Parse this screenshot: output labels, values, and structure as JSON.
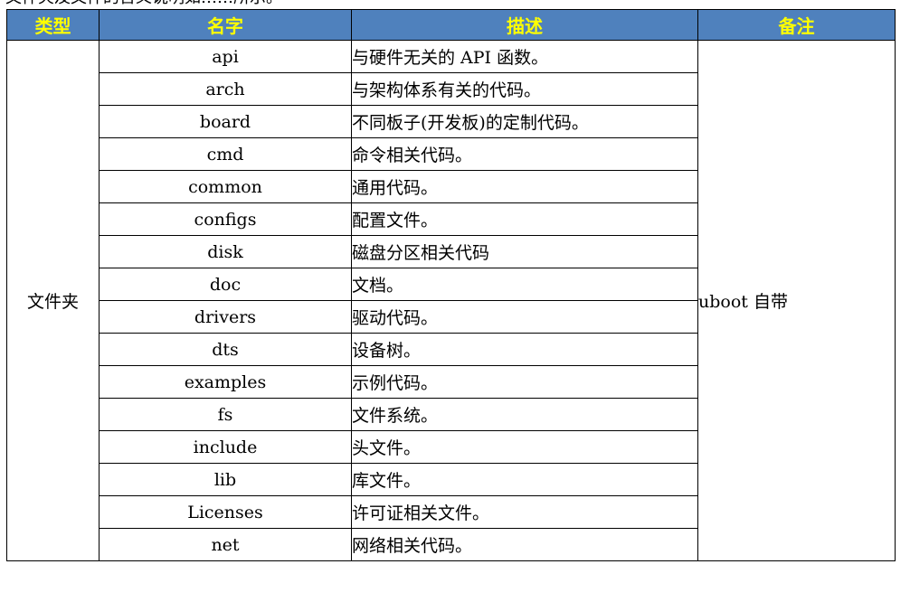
{
  "caption_fragment": "文件夹及文件的含义说明如……所示。",
  "table": {
    "headers": [
      "类型",
      "名字",
      "描述",
      "备注"
    ],
    "type": "文件夹",
    "note": "uboot 自带",
    "rows": [
      {
        "name": "api",
        "desc": "与硬件无关的 API 函数。"
      },
      {
        "name": "arch",
        "desc": "与架构体系有关的代码。"
      },
      {
        "name": "board",
        "desc": "不同板子(开发板)的定制代码。"
      },
      {
        "name": "cmd",
        "desc": "命令相关代码。"
      },
      {
        "name": "common",
        "desc": "通用代码。"
      },
      {
        "name": "configs",
        "desc": "配置文件。"
      },
      {
        "name": "disk",
        "desc": "磁盘分区相关代码"
      },
      {
        "name": "doc",
        "desc": "文档。"
      },
      {
        "name": "drivers",
        "desc": "驱动代码。"
      },
      {
        "name": "dts",
        "desc": "设备树。"
      },
      {
        "name": "examples",
        "desc": "示例代码。"
      },
      {
        "name": "fs",
        "desc": "文件系统。"
      },
      {
        "name": "include",
        "desc": "头文件。"
      },
      {
        "name": "lib",
        "desc": "库文件。"
      },
      {
        "name": "Licenses",
        "desc": "许可证相关文件。"
      },
      {
        "name": "net",
        "desc": "网络相关代码。"
      }
    ]
  },
  "colors": {
    "header_bg": "#4f81bd",
    "header_text": "#ffff00",
    "border": "#000000"
  }
}
